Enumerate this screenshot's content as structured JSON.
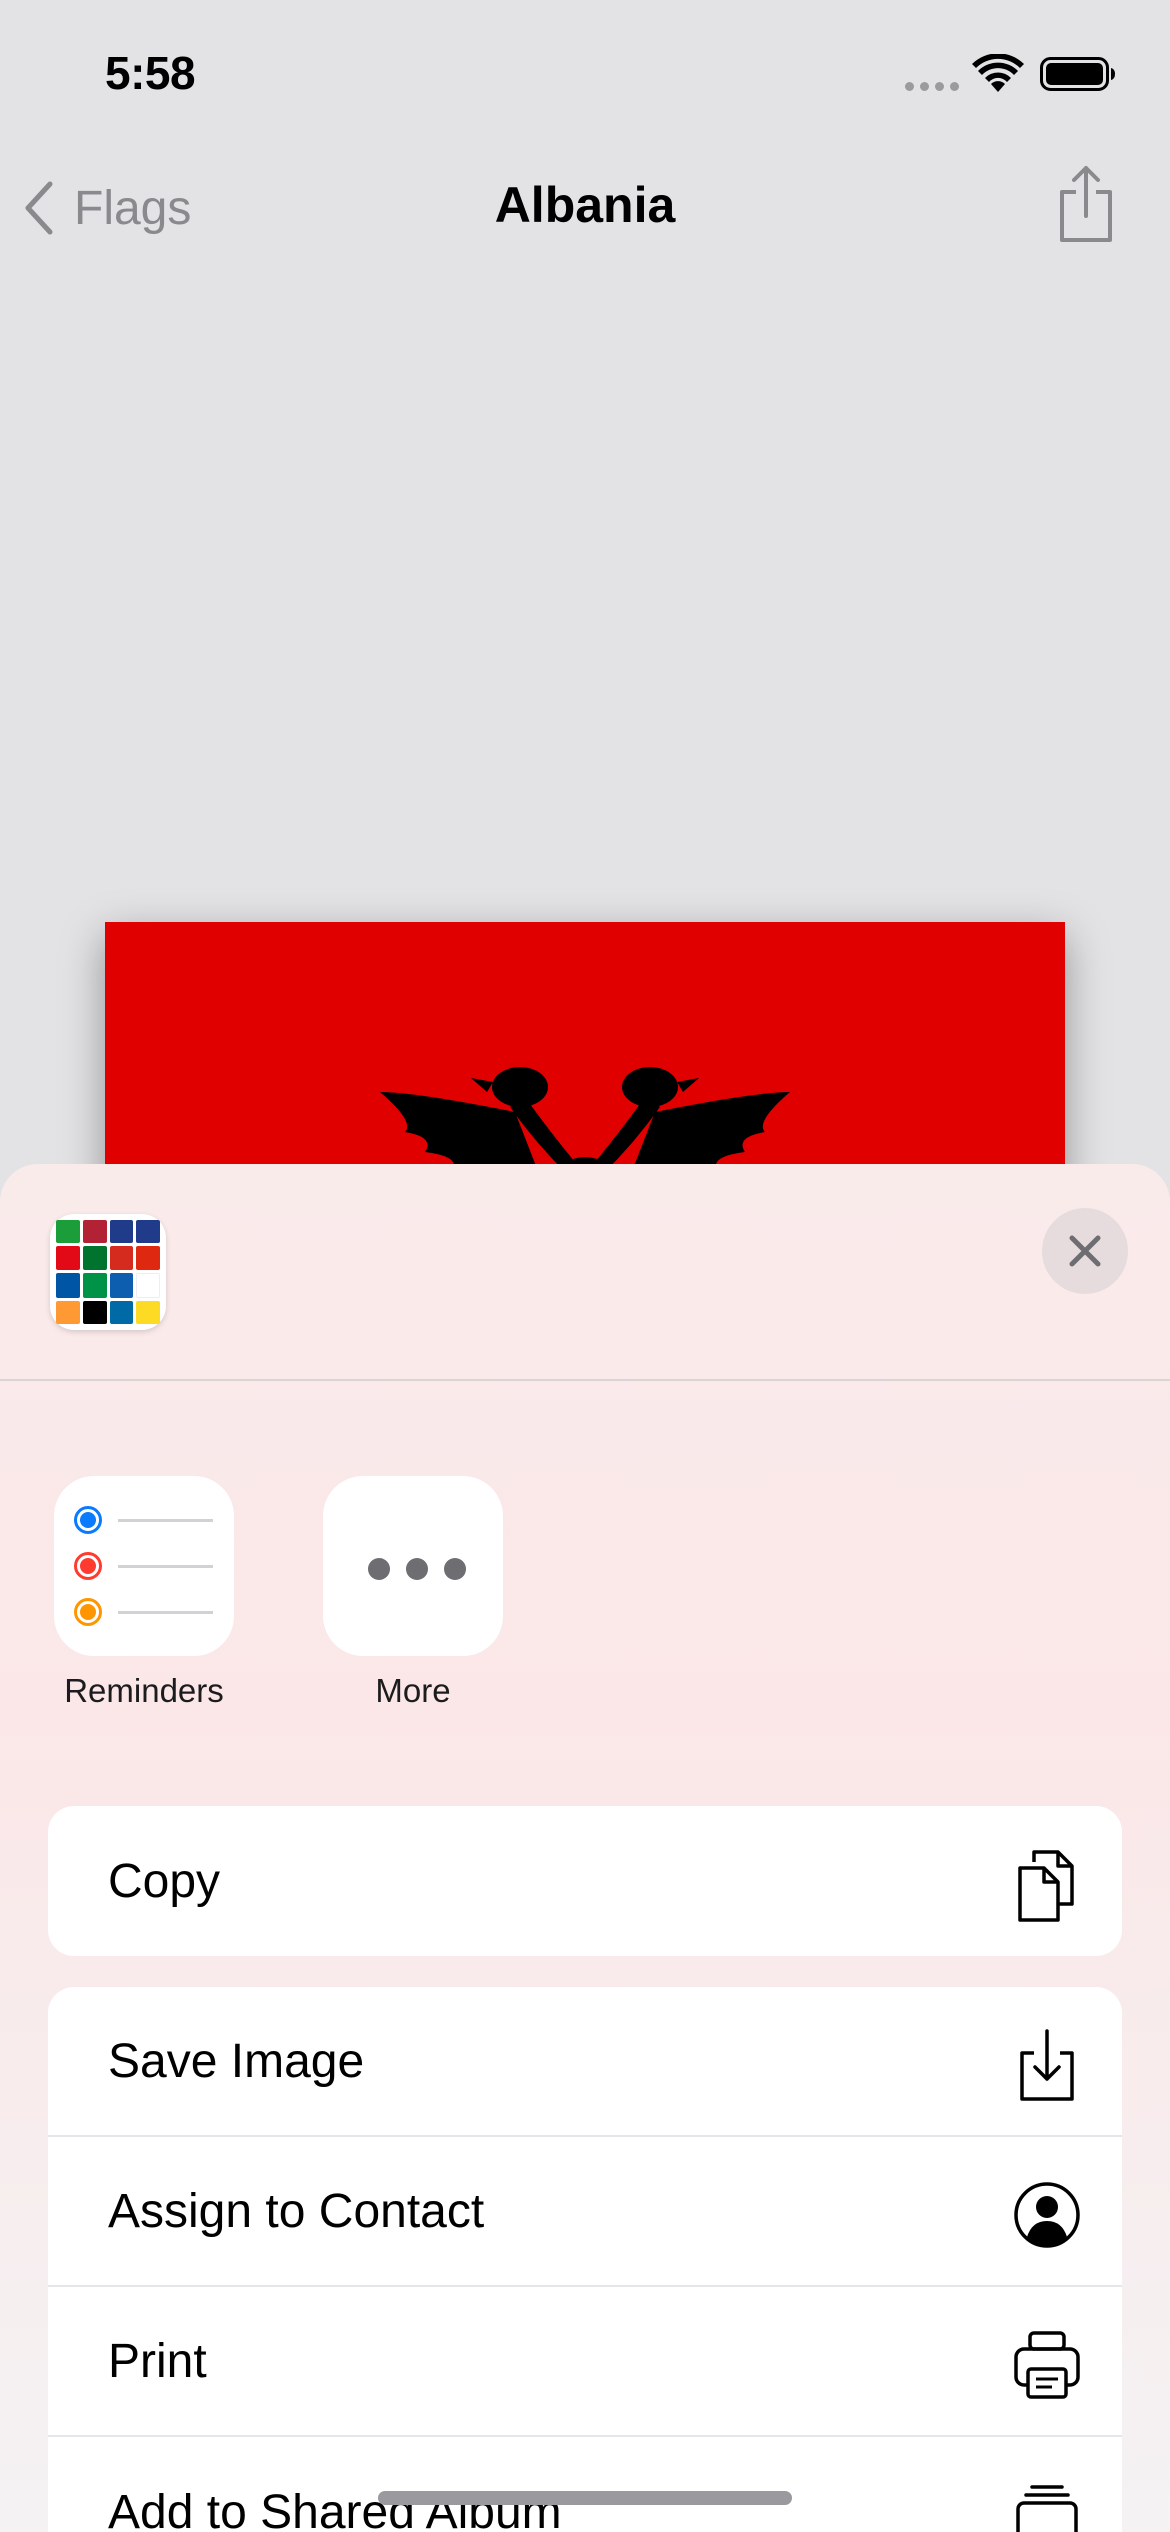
{
  "status_bar": {
    "time": "5:58",
    "icons": [
      "cellular-dots-icon",
      "wifi-icon",
      "battery-icon"
    ]
  },
  "nav": {
    "back_label": "Flags",
    "title": "Albania",
    "share_icon": "share-icon"
  },
  "flag": {
    "country": "Albania",
    "colors": {
      "field": "#e00000",
      "eagle": "#000000"
    }
  },
  "share_sheet": {
    "close_icon": "close-icon",
    "apps": [
      {
        "label": "Reminders",
        "icon": "reminders-icon"
      },
      {
        "label": "More",
        "icon": "more-icon"
      }
    ],
    "actions_primary": [
      {
        "label": "Copy",
        "icon": "copy-icon"
      }
    ],
    "actions": [
      {
        "label": "Save Image",
        "icon": "save-image-icon"
      },
      {
        "label": "Assign to Contact",
        "icon": "contact-icon"
      },
      {
        "label": "Print",
        "icon": "printer-icon"
      },
      {
        "label": "Add to Shared Album",
        "icon": "shared-album-icon"
      }
    ]
  }
}
